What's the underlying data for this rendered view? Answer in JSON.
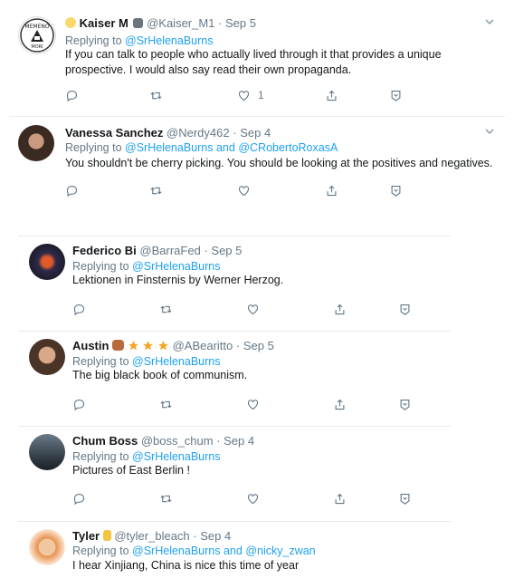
{
  "tweets": [
    {
      "name": "Kaiser M",
      "handle": "@Kaiser_M1",
      "dot": "·",
      "date": "Sep 5",
      "replying_prefix": "Replying to",
      "replying_to": "@SrHelenaBurns",
      "replying_and": "",
      "replying_to2": "",
      "text": "If you can talk to people who actually lived through it that provides a unique prospective. I would also say read their own propaganda.",
      "like_count": "1"
    },
    {
      "name": "Vanessa Sanchez",
      "handle": "@Nerdy462",
      "dot": "·",
      "date": "Sep 4",
      "replying_prefix": "Replying to",
      "replying_to": "@SrHelenaBurns",
      "replying_and": "and",
      "replying_to2": "@CRobertoRoxasA",
      "text": "You shouldn't be cherry picking. You should be looking at the positives and negatives."
    },
    {
      "name": "Federico Bi",
      "handle": "@BarraFed",
      "dot": "·",
      "date": "Sep 5",
      "replying_prefix": "Replying to",
      "replying_to": "@SrHelenaBurns",
      "text": "Lektionen in Finsternis by Werner Herzog."
    },
    {
      "name": "Austin",
      "handle": "@ABearitto",
      "dot": "·",
      "date": "Sep 5",
      "replying_prefix": "Replying to",
      "replying_to": "@SrHelenaBurns",
      "text": "The big black book of communism."
    },
    {
      "name": "Chum Boss",
      "handle": "@boss_chum",
      "dot": "·",
      "date": "Sep 4",
      "replying_prefix": "Replying to",
      "replying_to": "@SrHelenaBurns",
      "text": "Pictures of East Berlin !"
    },
    {
      "name": "Tyler",
      "handle": "@tyler_bleach",
      "dot": "·",
      "date": "Sep 4",
      "replying_prefix": "Replying to",
      "replying_to": "@SrHelenaBurns",
      "replying_and": "and",
      "replying_to2": "@nicky_zwan",
      "text": "I hear Xinjiang, China is nice this time of year"
    }
  ],
  "colors": {
    "link": "#1da1f2",
    "muted": "#657786",
    "text": "#14171a",
    "divider": "#e6ecf0"
  },
  "icons": [
    "reply-icon",
    "retweet-icon",
    "like-icon",
    "share-icon",
    "caret-down-icon",
    "verified-style-badge-icon",
    "star-icon",
    "bear-emoji-icon",
    "hand-emoji-icon"
  ]
}
